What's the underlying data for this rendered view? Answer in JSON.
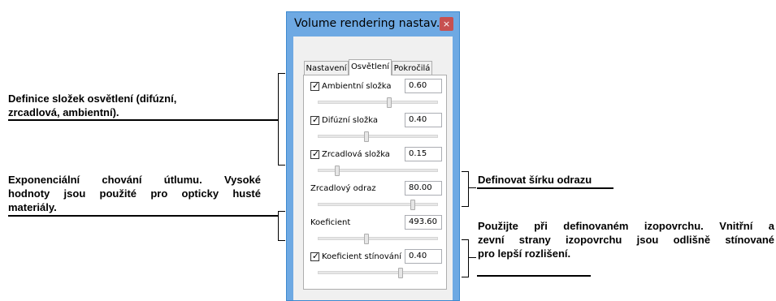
{
  "annotations": {
    "lighting": {
      "line1": "Definice složek osvětlení (difúzní,",
      "line2": "zrcadlová, ambientní)."
    },
    "attenuation": {
      "line1": "Exponenciální chování útlumu. Vysoké",
      "line2": "hodnoty jsou použité pro opticky husté",
      "line3": "materiály."
    },
    "reflection_width": "Definovat šírku odrazu",
    "isosurface": {
      "line1": "Použijte při definovaném izopovrchu. Vnitřní a",
      "line2": "zevní strany izopovrchu jsou odlišně stínované",
      "line3": "pro lepší rozlišení."
    }
  },
  "dialog": {
    "title": "Volume rendering nastav...",
    "close_label": "×",
    "tabs": [
      {
        "label": "Nastavení",
        "active": false
      },
      {
        "label": "Osvětlení",
        "active": true
      },
      {
        "label": "Pokročilá",
        "active": false
      }
    ],
    "check_glyph": "✓",
    "controls": {
      "ambient": {
        "label": "Ambientní složka",
        "checked": true,
        "value": "0.60",
        "slider": 0.6
      },
      "diffuse": {
        "label": "Difúzní složka",
        "checked": true,
        "value": "0.40",
        "slider": 0.4
      },
      "specular": {
        "label": "Zrcadlová složka",
        "checked": true,
        "value": "0.15",
        "slider": 0.15
      },
      "specular_reflection": {
        "label": "Zrcadlový odraz",
        "value": "80.00",
        "slider": 0.8
      },
      "coefficient": {
        "label": "Koeficient",
        "value": "493.60",
        "slider": 0.4
      },
      "shading_coefficient": {
        "label": "Koeficient stínování",
        "checked": true,
        "value": "0.40",
        "slider": 0.7
      }
    }
  }
}
